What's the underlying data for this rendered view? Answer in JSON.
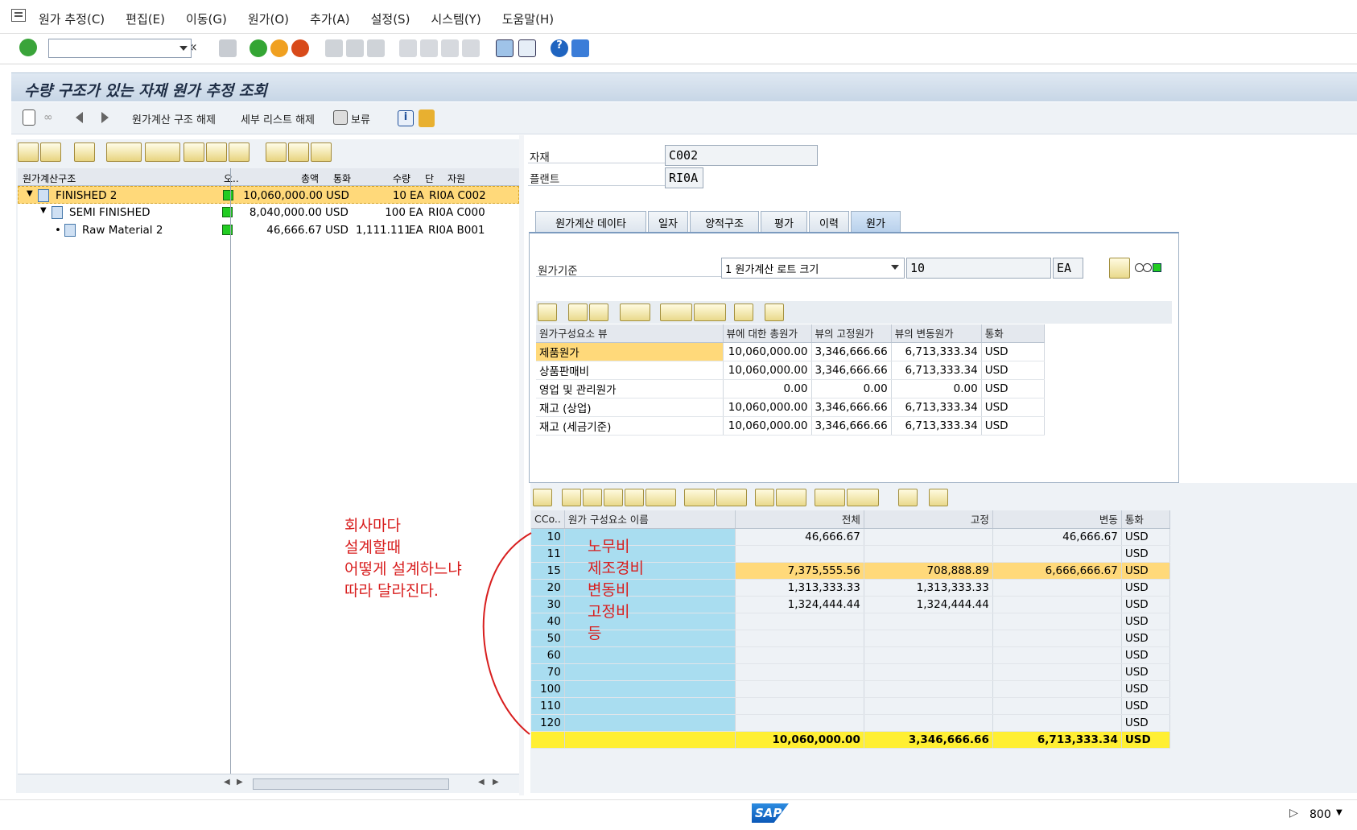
{
  "menu": [
    "원가 추정(C)",
    "편집(E)",
    "이동(G)",
    "원가(O)",
    "추가(A)",
    "설정(S)",
    "시스템(Y)",
    "도움말(H)"
  ],
  "title": "수량 구조가 있는 자재 원가 추정 조회",
  "appbar": {
    "btn1": "원가계산 구조 해제",
    "btn2": "세부 리스트 해제",
    "btn3": "보류"
  },
  "tree": {
    "headers": [
      "원가계산구조",
      "오..",
      "총액",
      "통화",
      "수량",
      "단",
      "자원"
    ],
    "rows": [
      {
        "name": "FINISHED 2",
        "amount": "10,060,000.00",
        "cur": "USD",
        "qty": "10",
        "unit": "EA",
        "res": "RI0A C002"
      },
      {
        "name": "SEMI FINISHED",
        "amount": "8,040,000.00",
        "cur": "USD",
        "qty": "100",
        "unit": "EA",
        "res": "RI0A C000"
      },
      {
        "name": "Raw Material 2",
        "amount": "46,666.67",
        "cur": "USD",
        "qty": "1,111.111",
        "unit": "EA",
        "res": "RI0A B001"
      }
    ]
  },
  "header_fields": {
    "material_label": "자재",
    "material": "C002",
    "plant_label": "플랜트",
    "plant": "RI0A"
  },
  "tabs": [
    "원가계산 데이타",
    "일자",
    "양적구조",
    "평가",
    "이력",
    "원가"
  ],
  "cost_base": {
    "label": "원가기준",
    "select": "1 원가계산 로트 크기",
    "qty": "10",
    "unit": "EA"
  },
  "view_grid": {
    "headers": [
      "원가구성요소 뷰",
      "뷰에 대한 총원가",
      "뷰의 고정원가",
      "뷰의 변동원가",
      "통화"
    ],
    "rows": [
      [
        "제품원가",
        "10,060,000.00",
        "3,346,666.66",
        "6,713,333.34",
        "USD"
      ],
      [
        "상품판매비",
        "10,060,000.00",
        "3,346,666.66",
        "6,713,333.34",
        "USD"
      ],
      [
        "영업 및 관리원가",
        "0.00",
        "0.00",
        "0.00",
        "USD"
      ],
      [
        "재고 (상업)",
        "10,060,000.00",
        "3,346,666.66",
        "6,713,333.34",
        "USD"
      ],
      [
        "재고 (세금기준)",
        "10,060,000.00",
        "3,346,666.66",
        "6,713,333.34",
        "USD"
      ]
    ]
  },
  "comp_grid": {
    "headers": [
      "CCo..",
      "원가 구성요소 이름",
      "전체",
      "고정",
      "변동",
      "통화"
    ],
    "rows": [
      [
        "10",
        "",
        "46,666.67",
        "",
        "46,666.67",
        "USD"
      ],
      [
        "11",
        "",
        "",
        "",
        "",
        "USD"
      ],
      [
        "15",
        "",
        "7,375,555.56",
        "708,888.89",
        "6,666,666.67",
        "USD"
      ],
      [
        "20",
        "",
        "1,313,333.33",
        "1,313,333.33",
        "",
        "USD"
      ],
      [
        "30",
        "",
        "1,324,444.44",
        "1,324,444.44",
        "",
        "USD"
      ],
      [
        "40",
        "",
        "",
        "",
        "",
        "USD"
      ],
      [
        "50",
        "",
        "",
        "",
        "",
        "USD"
      ],
      [
        "60",
        "",
        "",
        "",
        "",
        "USD"
      ],
      [
        "70",
        "",
        "",
        "",
        "",
        "USD"
      ],
      [
        "100",
        "",
        "",
        "",
        "",
        "USD"
      ],
      [
        "110",
        "",
        "",
        "",
        "",
        "USD"
      ],
      [
        "120",
        "",
        "",
        "",
        "",
        "USD"
      ]
    ],
    "sum": [
      "10,060,000.00",
      "3,346,666.66",
      "6,713,333.34",
      "USD"
    ]
  },
  "annotation": {
    "left_lines": [
      "회사마다",
      "설계할때",
      "어떻게 설계하느냐",
      "따라 달라진다."
    ],
    "right_lines": [
      "노무비",
      "제조경비",
      "변동비",
      "고정비",
      "등"
    ]
  },
  "status": {
    "client": "800"
  },
  "colors": {
    "selection": "#ffd97a",
    "component_col": "#a9ddf0",
    "sum_row": "#ffef33",
    "annotation": "#d81e1e"
  }
}
